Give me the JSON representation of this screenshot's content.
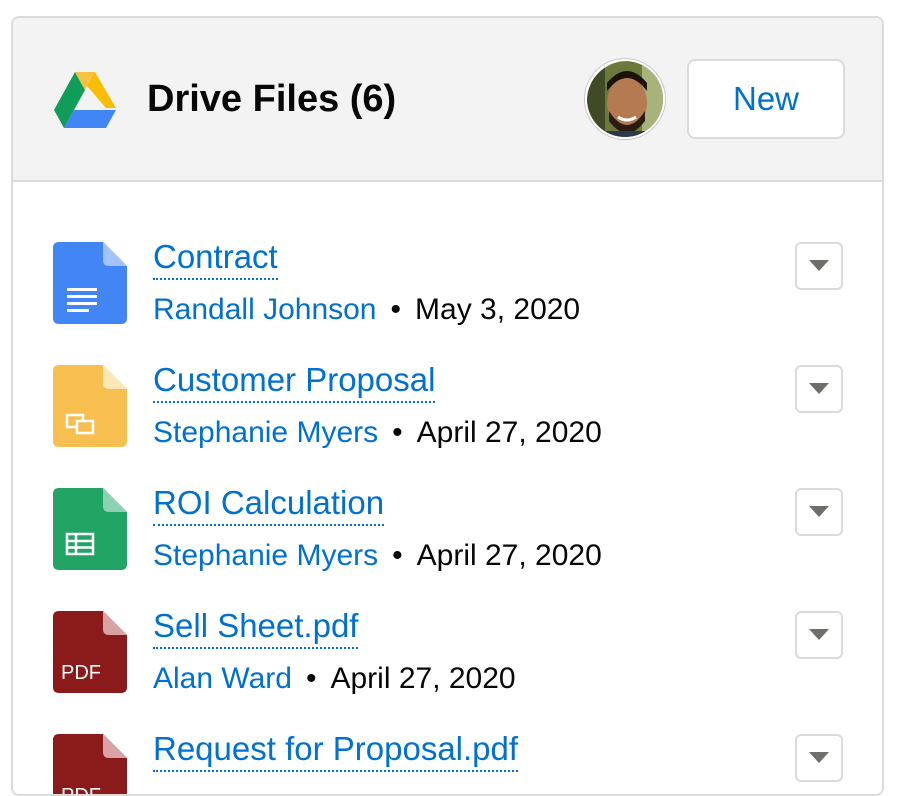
{
  "header": {
    "logo_icon": "google-drive-logo-icon",
    "title": "Drive Files (6)",
    "avatar_icon": "user-avatar",
    "new_button_label": "New"
  },
  "files": [
    {
      "name": "Contract",
      "owner": "Randall Johnson",
      "separator": "•",
      "date": "May 3, 2020",
      "type": "google-doc",
      "icon": "google-docs-icon",
      "icon_color": "#4285f4",
      "menu_icon": "chevron-down-icon"
    },
    {
      "name": "Customer Proposal",
      "owner": "Stephanie Myers",
      "separator": "•",
      "date": "April 27, 2020",
      "type": "google-slides",
      "icon": "google-slides-icon",
      "icon_color": "#f6bf4f",
      "menu_icon": "chevron-down-icon"
    },
    {
      "name": "ROI Calculation",
      "owner": "Stephanie Myers",
      "separator": "•",
      "date": "April 27, 2020",
      "type": "google-sheets",
      "icon": "google-sheets-icon",
      "icon_color": "#21a464",
      "menu_icon": "chevron-down-icon"
    },
    {
      "name": "Sell Sheet.pdf",
      "owner": "Alan Ward",
      "separator": "•",
      "date": "April 27, 2020",
      "type": "pdf",
      "icon": "pdf-file-icon",
      "icon_label": "PDF",
      "icon_color": "#8b1a1a",
      "menu_icon": "chevron-down-icon"
    },
    {
      "name": "Request for Proposal.pdf",
      "owner": "",
      "separator": "",
      "date": "",
      "type": "pdf",
      "icon": "pdf-file-icon",
      "icon_label": "PDF",
      "icon_color": "#8b1a1a",
      "menu_icon": "chevron-down-icon"
    }
  ],
  "colors": {
    "link": "#0070d2",
    "header_bg": "#f3f3f3",
    "border": "#dddbda",
    "text": "#080707"
  }
}
